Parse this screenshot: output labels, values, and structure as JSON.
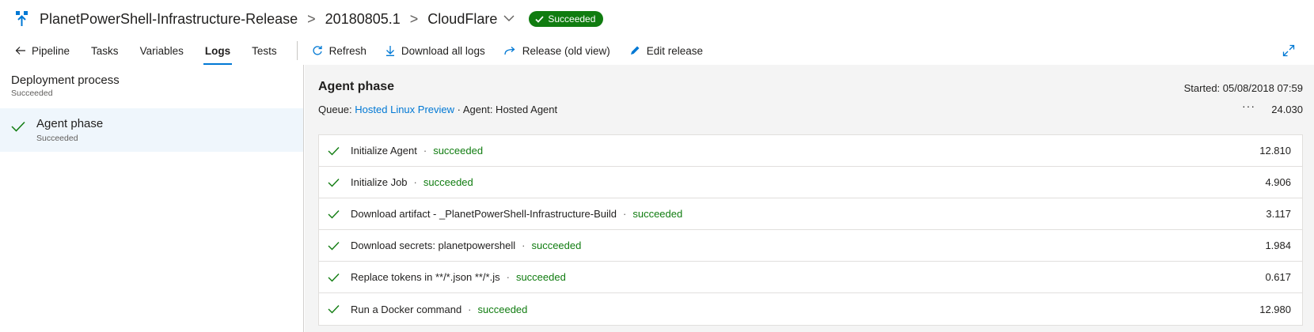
{
  "header": {
    "release_name": "PlanetPowerShell-Infrastructure-Release",
    "release_number": "20180805.1",
    "environment": "CloudFlare",
    "status": "Succeeded",
    "separator": ">"
  },
  "toolbar": {
    "tabs": [
      {
        "label": "Pipeline",
        "icon": "arrow-left-icon"
      },
      {
        "label": "Tasks"
      },
      {
        "label": "Variables"
      },
      {
        "label": "Logs",
        "active": true
      },
      {
        "label": "Tests"
      }
    ],
    "actions": [
      {
        "label": "Refresh",
        "icon": "refresh-icon"
      },
      {
        "label": "Download all logs",
        "icon": "download-icon"
      },
      {
        "label": "Release (old view)",
        "icon": "redirect-icon"
      },
      {
        "label": "Edit release",
        "icon": "pencil-icon"
      }
    ]
  },
  "left_panel": {
    "title": "Deployment process",
    "status": "Succeeded",
    "phase": {
      "name": "Agent phase",
      "status": "Succeeded"
    }
  },
  "right_panel": {
    "title": "Agent phase",
    "started": "Started: 05/08/2018 07:59",
    "queue_label": "Queue:",
    "queue_value": "Hosted Linux Preview",
    "agent_text": "· Agent: Hosted Agent",
    "more": "···",
    "duration": "24.030",
    "tasks": [
      {
        "name": "Initialize Agent",
        "status": "succeeded",
        "duration": "12.810"
      },
      {
        "name": "Initialize Job",
        "status": "succeeded",
        "duration": "4.906"
      },
      {
        "name": "Download artifact - _PlanetPowerShell-Infrastructure-Build",
        "status": "succeeded",
        "duration": "3.117"
      },
      {
        "name": "Download secrets: planetpowershell",
        "status": "succeeded",
        "duration": "1.984"
      },
      {
        "name": "Replace tokens in **/*.json **/*.js",
        "status": "succeeded",
        "duration": "0.617"
      },
      {
        "name": "Run a Docker command",
        "status": "succeeded",
        "duration": "12.980"
      }
    ]
  },
  "colors": {
    "accent": "#0078d4",
    "success": "#107c10"
  }
}
